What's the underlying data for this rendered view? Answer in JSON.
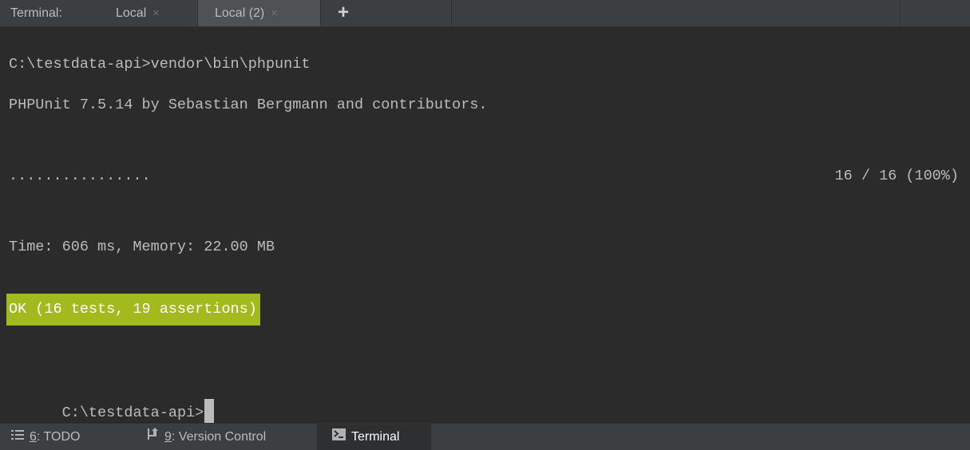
{
  "tabbar": {
    "label": "Terminal:",
    "tabs": [
      {
        "label": "Local",
        "close": "×",
        "active": false
      },
      {
        "label": "Local (2)",
        "close": "×",
        "active": true
      }
    ],
    "add": "+"
  },
  "terminal": {
    "lines": [
      "C:\\testdata-api>vendor\\bin\\phpunit",
      "PHPUnit 7.5.14 by Sebastian Bergmann and contributors.",
      "................",
      "Time: 606 ms, Memory: 22.00 MB",
      "OK (16 tests, 19 assertions)",
      "C:\\testdata-api>"
    ],
    "progress": "16 / 16 (100%)",
    "ok_color": "#a3ba1e"
  },
  "toolbar": {
    "tools": [
      {
        "number": "6",
        "label": ": TODO",
        "icon": "list-icon"
      },
      {
        "number": "9",
        "label": ": Version Control",
        "icon": "version-control-icon"
      },
      {
        "label": "Terminal",
        "icon": "terminal-icon",
        "active": true
      }
    ]
  }
}
